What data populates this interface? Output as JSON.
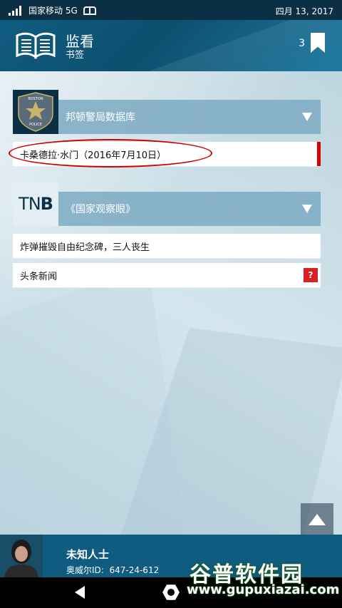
{
  "status": {
    "carrier": "国家移动 5G",
    "date": "四月 13, 2017"
  },
  "appbar": {
    "title": "监看",
    "subtitle": "书签",
    "count": "3"
  },
  "sections": [
    {
      "header": "邦顿警局数据库",
      "thumb_badge_top": "BOSTON",
      "thumb_badge_bottom": "POLICE",
      "items": [
        {
          "label": "卡桑德拉·水门（2016年7月10日）"
        }
      ]
    },
    {
      "header": "《国家观察眼》",
      "logo": {
        "light": "TN",
        "bold": "B"
      },
      "items": [
        {
          "label": "炸弹摧毁自由纪念碑，三人丧生"
        },
        {
          "label": "头条新闻",
          "badge": "?"
        }
      ]
    }
  ],
  "user": {
    "name": "未知人士",
    "id_label": "奥威尔ID:",
    "id_value": "647-24-612"
  },
  "watermark": {
    "title": "谷普软件园",
    "url": "www.gupuxiazai.com"
  },
  "colors": {
    "appbar": "#0f5c80",
    "header_bar": "#7daac3",
    "marker": "#dd0000",
    "badge": "#d62222"
  }
}
